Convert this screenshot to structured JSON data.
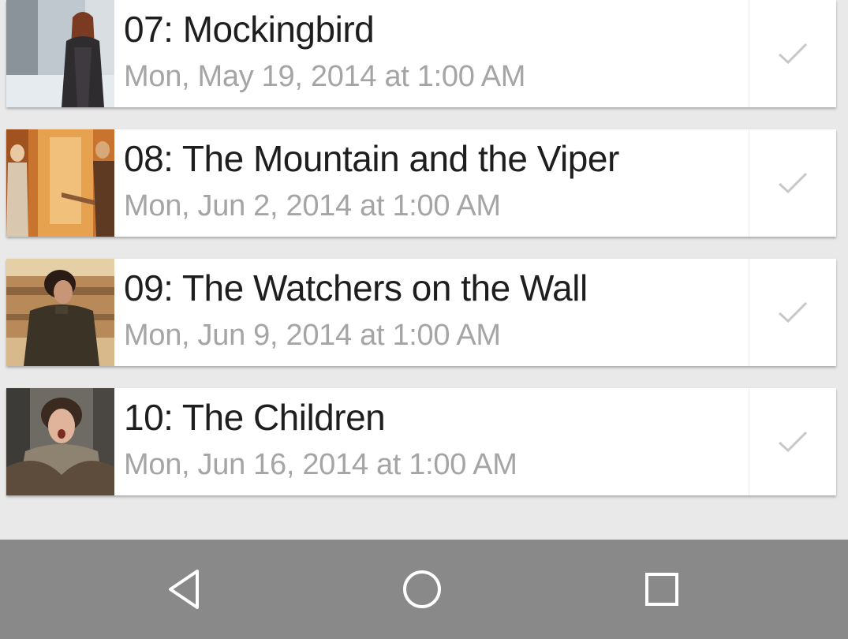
{
  "episodes": [
    {
      "title": "07: Mockingbird",
      "date": "Mon, May 19, 2014 at 1:00 AM",
      "thumbnail": "woman-in-snow-thumbnail",
      "watched_icon": "checkmark-icon"
    },
    {
      "title": "08: The Mountain and the Viper",
      "date": "Mon, Jun 2, 2014 at 1:00 AM",
      "thumbnail": "warm-interior-scene-thumbnail",
      "watched_icon": "checkmark-icon"
    },
    {
      "title": "09: The Watchers on the Wall",
      "date": "Mon, Jun 9, 2014 at 1:00 AM",
      "thumbnail": "man-in-dark-coat-thumbnail",
      "watched_icon": "checkmark-icon"
    },
    {
      "title": "10: The Children",
      "date": "Mon, Jun 16, 2014 at 1:00 AM",
      "thumbnail": "boy-shouting-thumbnail",
      "watched_icon": "checkmark-icon"
    }
  ],
  "navigation_bar": {
    "back_icon": "back-triangle-icon",
    "home_icon": "home-circle-icon",
    "recents_icon": "recents-square-icon"
  },
  "colors": {
    "background": "#e9e9e9",
    "card": "#ffffff",
    "title_text": "#1e1e1e",
    "date_text": "#a5a5a5",
    "check": "#c8c8c8",
    "navbar": "#898989"
  }
}
